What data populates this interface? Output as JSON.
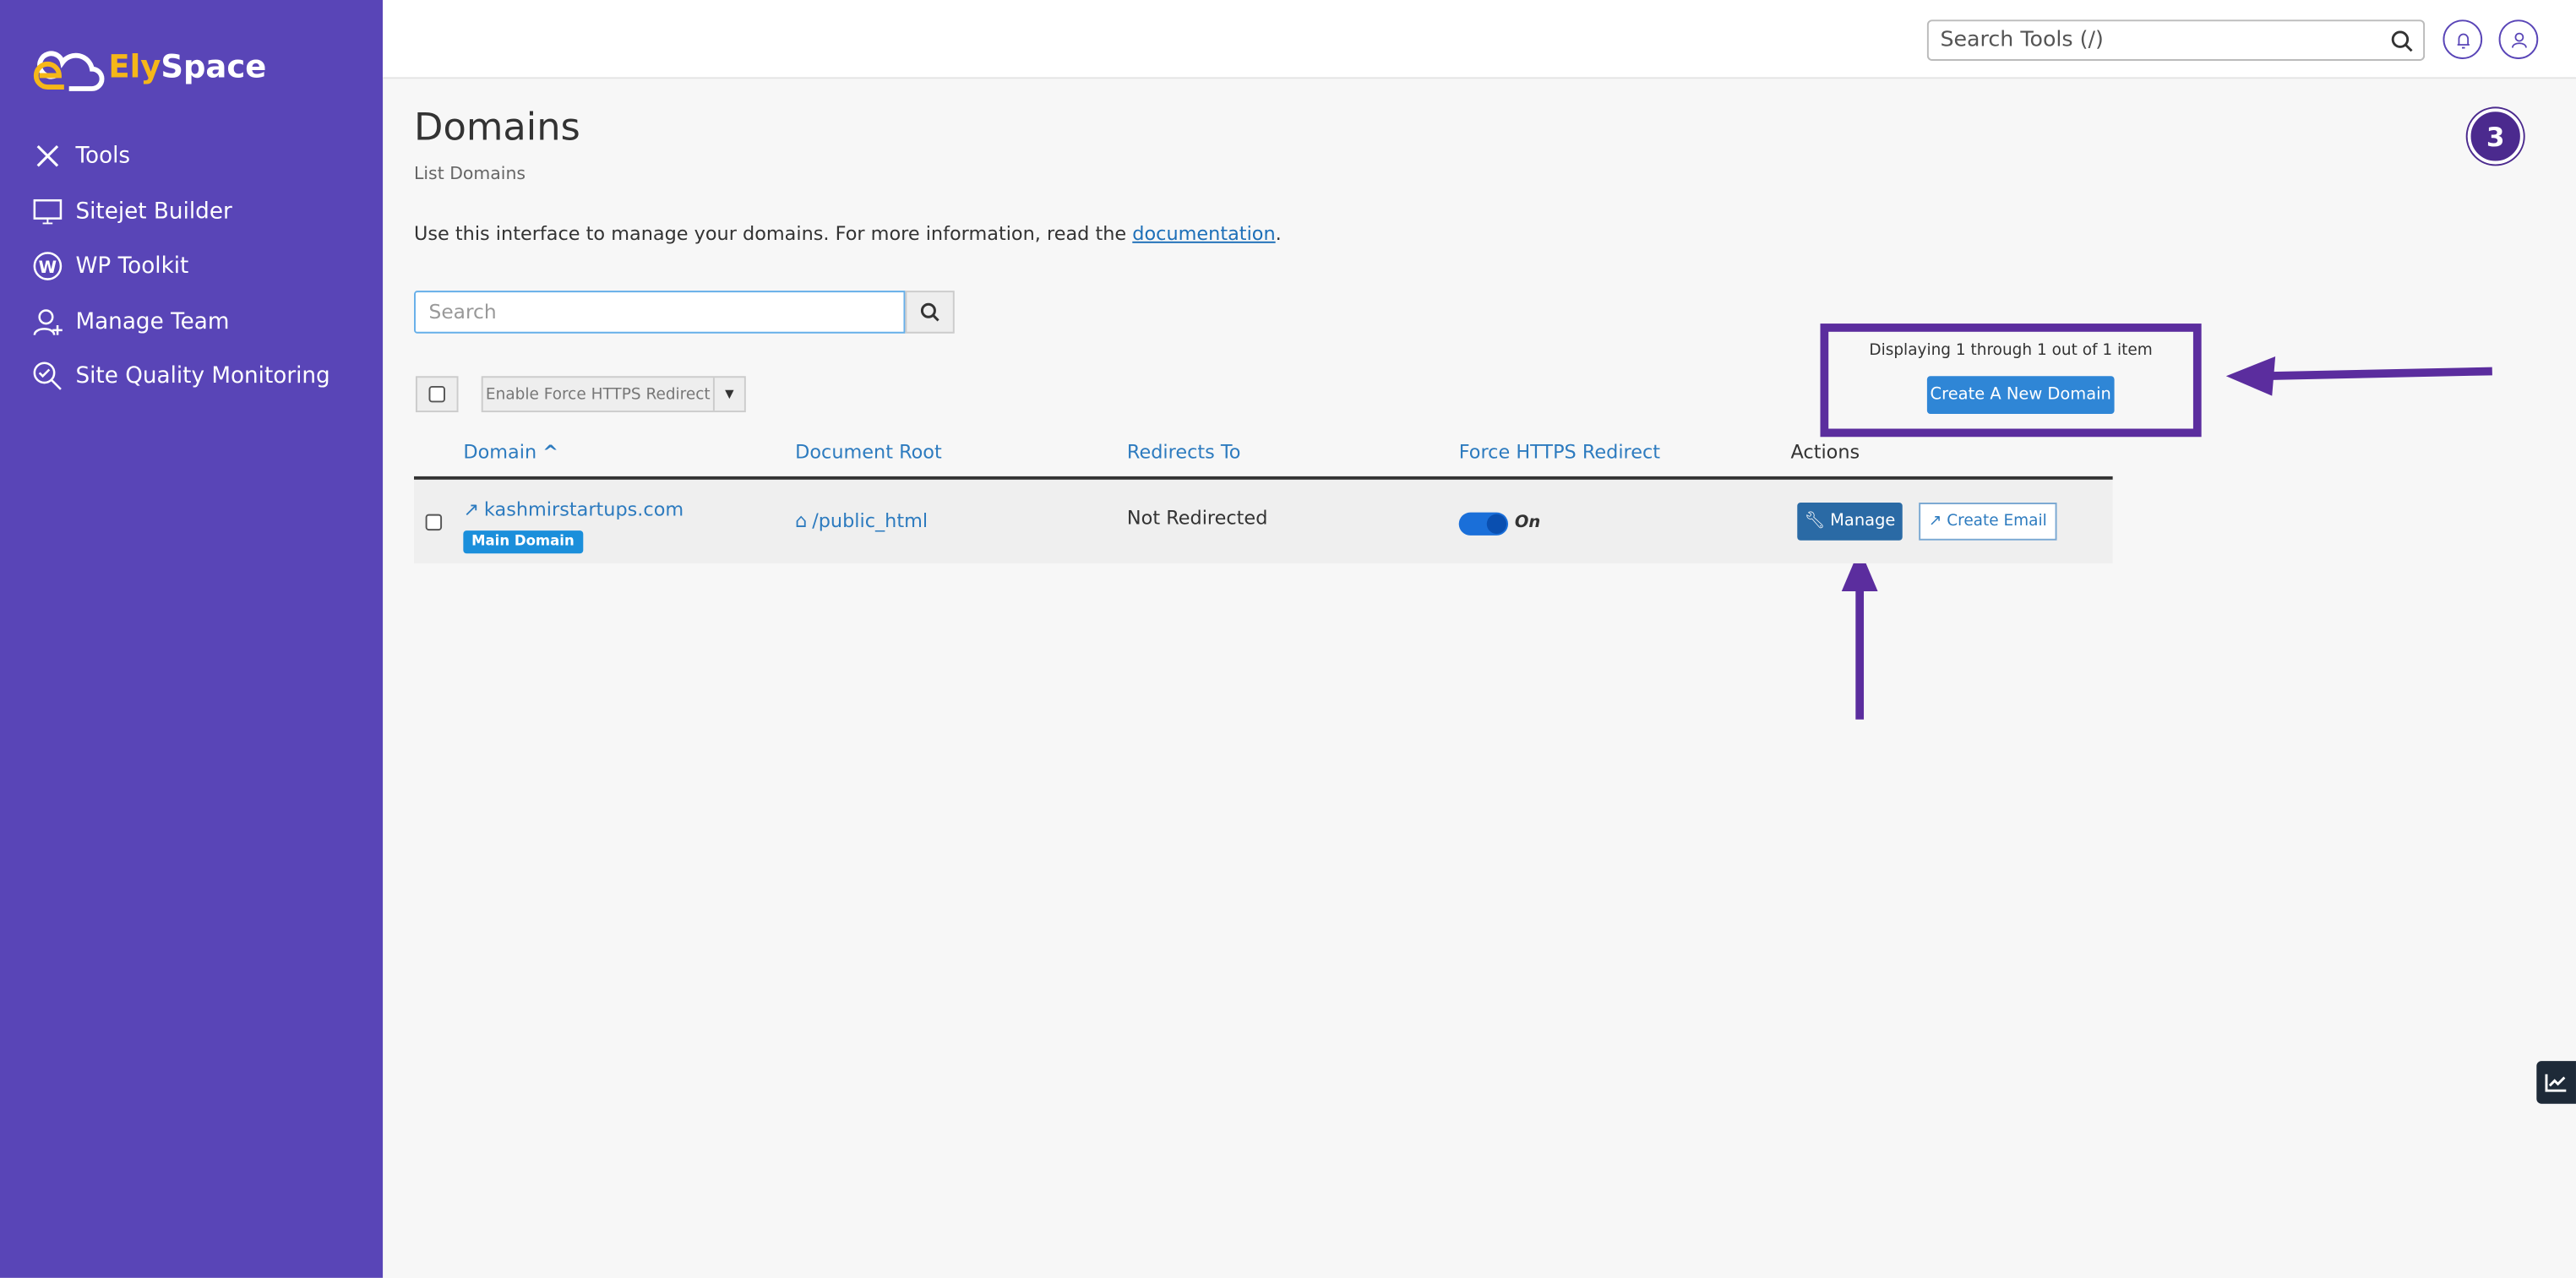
{
  "brand": {
    "name_part1": "Ely",
    "name_part2": "Space"
  },
  "sidebar": {
    "items": [
      {
        "label": "Tools",
        "icon": "tools-icon"
      },
      {
        "label": "Sitejet Builder",
        "icon": "sitejet-icon"
      },
      {
        "label": "WP Toolkit",
        "icon": "wordpress-icon"
      },
      {
        "label": "Manage Team",
        "icon": "add-user-icon"
      },
      {
        "label": "Site Quality Monitoring",
        "icon": "quality-search-icon"
      }
    ]
  },
  "topbar": {
    "search_placeholder": "Search Tools (/)"
  },
  "page": {
    "title": "Domains",
    "subtitle": "List Domains",
    "description": "Use this interface to manage your domains. For more information, read the ",
    "doc_link": "documentation",
    "desc_end": ".",
    "step_badge": "3"
  },
  "search": {
    "placeholder": "Search"
  },
  "bulk": {
    "action_label": "Enable Force HTTPS Redirect"
  },
  "pagination": {
    "text": "Displaying 1 through 1 out of 1 item"
  },
  "create_button": "Create A New Domain",
  "table": {
    "headers": [
      "Domain",
      "Document Root",
      "Redirects To",
      "Force HTTPS Redirect",
      "Actions"
    ],
    "rows": [
      {
        "domain": "kashmirstartups.com",
        "badge": "Main Domain",
        "doc_root": "/public_html",
        "redirects": "Not Redirected",
        "https": "On",
        "https_enabled": true,
        "manage": "Manage",
        "create_email": "Create Email"
      }
    ]
  },
  "colors": {
    "sidebar": "#5945b7",
    "annotation": "#5b2d9e",
    "primary": "#2a6aa5"
  }
}
